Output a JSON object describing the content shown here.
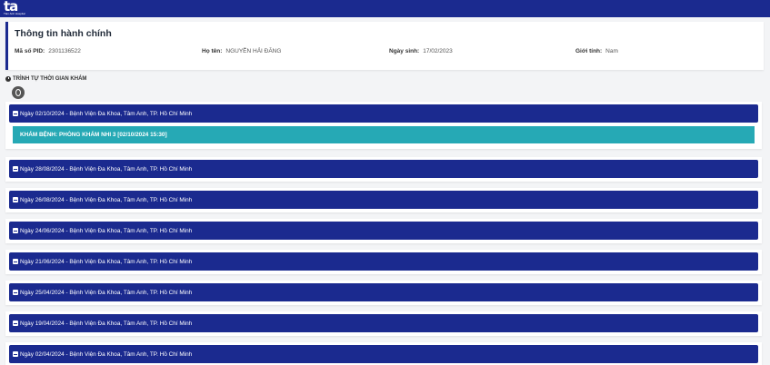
{
  "brand": {
    "logo_text": "ta",
    "logo_sub": "Tâm Anh Hospital"
  },
  "patient": {
    "section_title": "Thông tin hành chính",
    "pid_label": "Mã số PID:",
    "pid_value": "2301136522",
    "name_label": "Họ tên:",
    "name_value": "NGUYỄN HẢI ĐĂNG",
    "dob_label": "Ngày sinh:",
    "dob_value": "17/02/2023",
    "gender_label": "Giới tính:",
    "gender_value": "Nam"
  },
  "timeline": {
    "heading": "TRÌNH TỰ THỜI GIAN KHÁM",
    "visits": [
      {
        "label": "Ngày 02/10/2024 - Bệnh Viện Đa Khoa, Tâm Anh, TP. Hồ Chí Minh",
        "detail": "KHÁM BỆNH: PHÒNG KHÁM NHI 3 [02/10/2024 15:30]"
      },
      {
        "label": "Ngày 28/08/2024 - Bệnh Viện Đa Khoa, Tâm Anh, TP. Hồ Chí Minh"
      },
      {
        "label": "Ngày 26/08/2024 - Bệnh Viện Đa Khoa, Tâm Anh, TP. Hồ Chí Minh"
      },
      {
        "label": "Ngày 24/06/2024 - Bệnh Viện Đa Khoa, Tâm Anh, TP. Hồ Chí Minh"
      },
      {
        "label": "Ngày 21/06/2024 - Bệnh Viện Đa Khoa, Tâm Anh, TP. Hồ Chí Minh"
      },
      {
        "label": "Ngày 25/04/2024 - Bệnh Viện Đa Khoa, Tâm Anh, TP. Hồ Chí Minh"
      },
      {
        "label": "Ngày 19/04/2024 - Bệnh Viện Đa Khoa, Tâm Anh, TP. Hồ Chí Minh"
      },
      {
        "label": "Ngày 02/04/2024 - Bệnh Viện Đa Khoa, Tâm Anh, TP. Hồ Chí Minh"
      }
    ]
  },
  "colors": {
    "primary": "#1b2a8f",
    "detail": "#26a9b5"
  },
  "icons": {
    "visit": "calendar-check-icon",
    "timeline": "clock-icon"
  }
}
